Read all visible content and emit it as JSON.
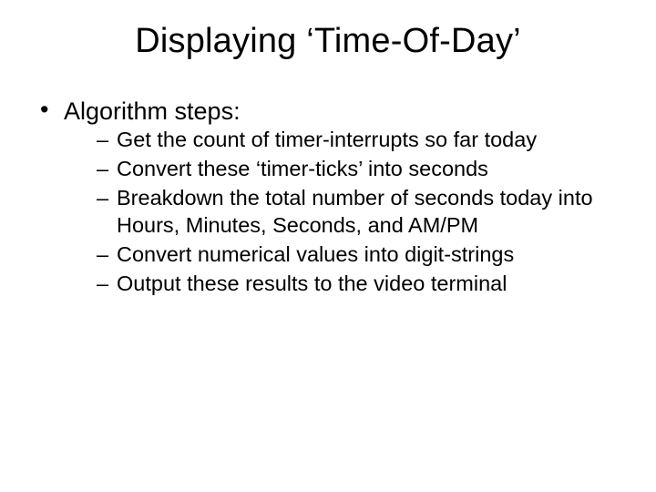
{
  "slide": {
    "title": "Displaying ‘Time-Of-Day’",
    "bullet1": "Algorithm steps:",
    "subitems": {
      "i0": "Get the count of timer-interrupts so far today",
      "i1": "Convert these ‘timer-ticks’ into seconds",
      "i2": "Breakdown the total number of seconds today into Hours, Minutes, Seconds, and AM/PM",
      "i3": "Convert numerical values into digit-strings",
      "i4": "Output these results to the video terminal"
    }
  }
}
